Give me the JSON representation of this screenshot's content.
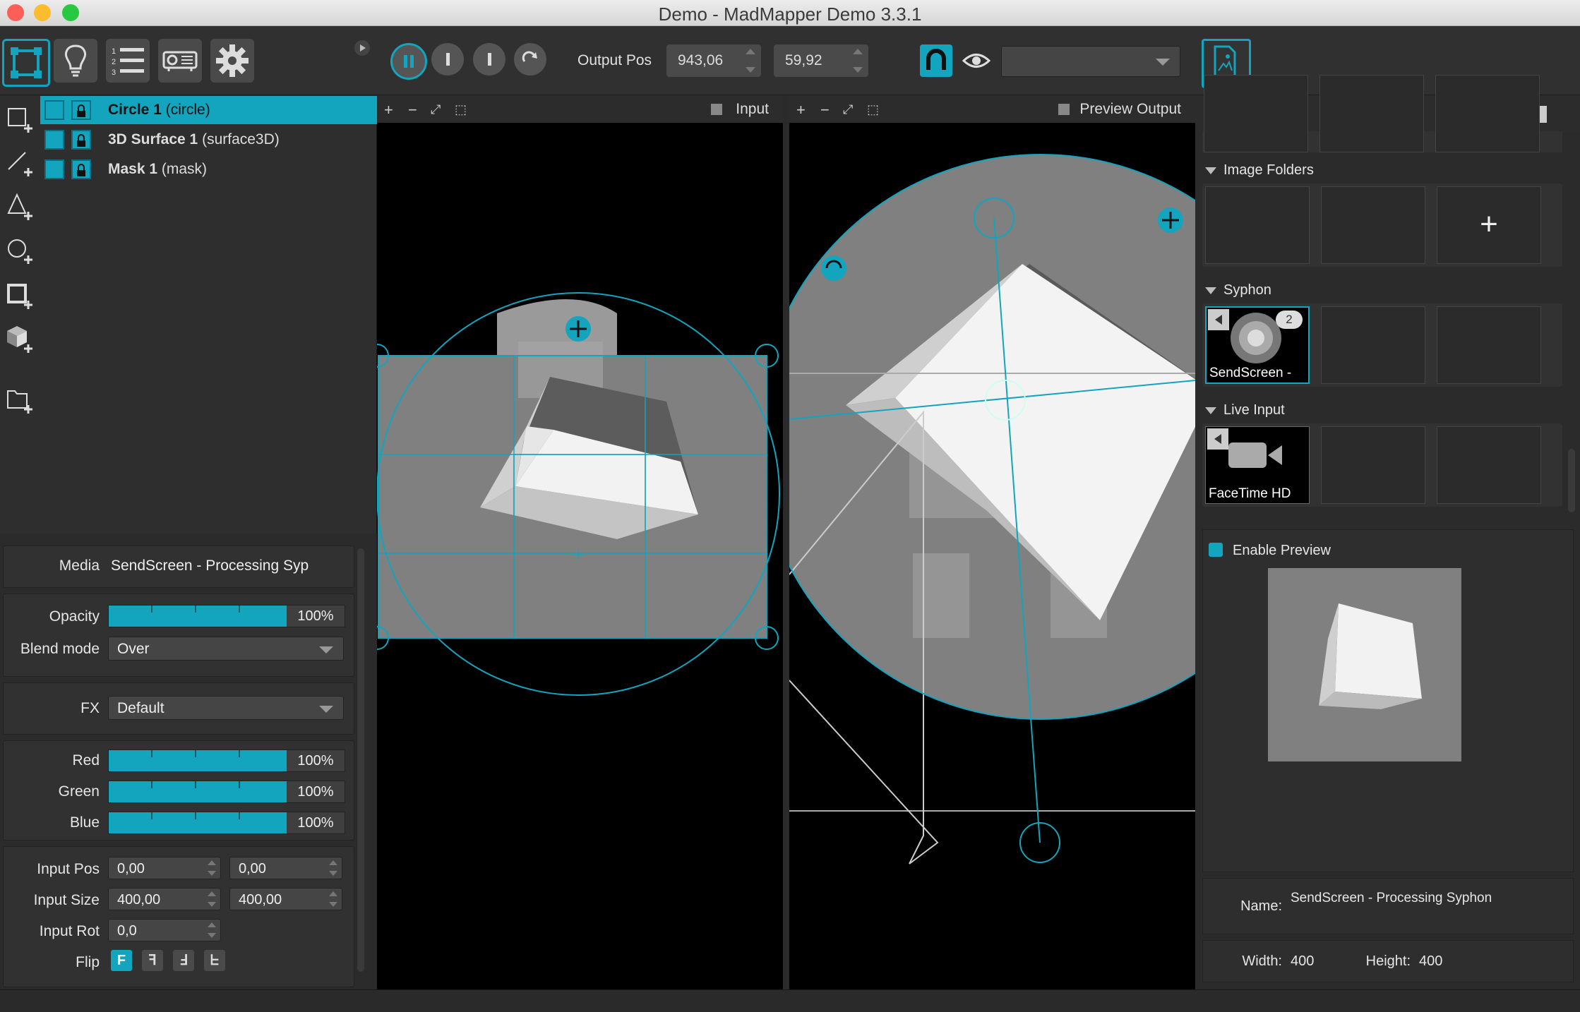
{
  "window": {
    "title": "Demo - MadMapper Demo 3.3.1"
  },
  "toolbar": {
    "output_pos_label": "Output Pos",
    "output_pos_x": "943,06",
    "output_pos_y": "59,92",
    "output_select_value": ""
  },
  "layers": [
    {
      "name": "Circle 1",
      "type": "(circle)",
      "selected": true
    },
    {
      "name": "3D Surface 1",
      "type": "(surface3D)",
      "selected": false
    },
    {
      "name": "Mask 1",
      "type": "(mask)",
      "selected": false
    }
  ],
  "properties": {
    "media_label": "Media",
    "media_value": "SendScreen - Processing Syp",
    "opacity_label": "Opacity",
    "opacity_value": "100%",
    "opacity_level": 1.0,
    "blend_label": "Blend mode",
    "blend_value": "Over",
    "fx_label": "FX",
    "fx_value": "Default",
    "red_label": "Red",
    "red_value": "100%",
    "green_label": "Green",
    "green_value": "100%",
    "blue_label": "Blue",
    "blue_value": "100%",
    "input_pos_label": "Input Pos",
    "input_pos_x": "0,00",
    "input_pos_y": "0,00",
    "input_size_label": "Input Size",
    "input_size_w": "400,00",
    "input_size_h": "400,00",
    "input_rot_label": "Input Rot",
    "input_rot_value": "0,0",
    "flip_label": "Flip",
    "flip_buttons": [
      "F",
      "ꟻ",
      "Ⅎ",
      "ᖶ"
    ]
  },
  "viewports": {
    "input_label": "Input",
    "preview_label": "Preview Output"
  },
  "library": {
    "image_folders_label": "Image Folders",
    "syphon_label": "Syphon",
    "syphon_item": "SendScreen -",
    "syphon_badge": "2",
    "live_input_label": "Live Input",
    "live_item": "FaceTime HD",
    "add_symbol": "+"
  },
  "preview": {
    "enable_label": "Enable Preview",
    "name_label": "Name:",
    "name_value": "SendScreen - Processing Syphon",
    "width_label": "Width:",
    "width_value": "400",
    "height_label": "Height:",
    "height_value": "400"
  },
  "colors": {
    "accent": "#13a4be",
    "background": "#2b2b2b"
  }
}
